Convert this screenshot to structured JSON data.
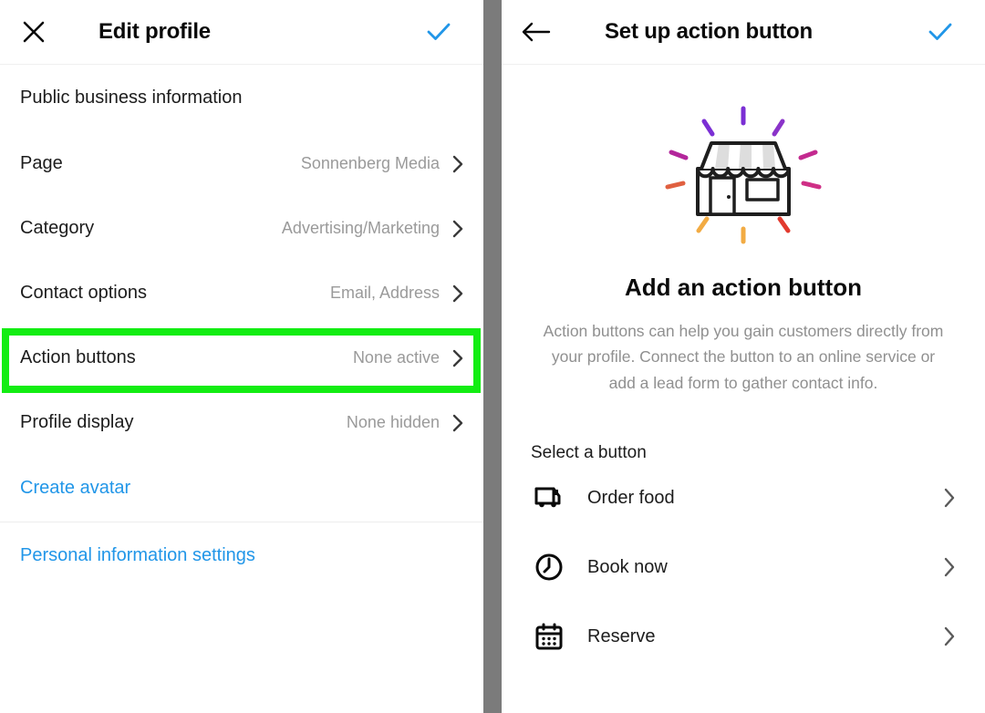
{
  "left_panel": {
    "header": {
      "close_icon": "close-icon",
      "title": "Edit profile",
      "confirm_icon": "check-icon"
    },
    "section_label": "Public business information",
    "rows": [
      {
        "label": "Page",
        "value": "Sonnenberg Media",
        "chevron": "chevron-right-icon"
      },
      {
        "label": "Category",
        "value": "Advertising/Marketing",
        "chevron": "chevron-right-icon"
      },
      {
        "label": "Contact options",
        "value": "Email, Address",
        "chevron": "chevron-right-icon"
      },
      {
        "label": "Action buttons",
        "value": "None active",
        "chevron": "chevron-right-icon"
      },
      {
        "label": "Profile display",
        "value": "None hidden",
        "chevron": "chevron-right-icon"
      }
    ],
    "links": [
      {
        "label": "Create avatar"
      },
      {
        "label": "Personal information settings"
      }
    ],
    "highlight_color": "#13ed13",
    "highlighted_row": "Action buttons"
  },
  "right_panel": {
    "header": {
      "back_icon": "arrow-left-icon",
      "title": "Set up action button",
      "confirm_icon": "check-icon"
    },
    "illustration": "storefront-icon",
    "hero_title": "Add an action button",
    "hero_body": "Action buttons can help you gain customers directly from your profile. Connect the button to an online service or add a lead form to gather contact info.",
    "select_label": "Select a button",
    "options": [
      {
        "label": "Order food",
        "icon": "delivery-truck-icon",
        "chevron": "chevron-right-icon"
      },
      {
        "label": "Book now",
        "icon": "clock-icon",
        "chevron": "chevron-right-icon"
      },
      {
        "label": "Reserve",
        "icon": "calendar-icon",
        "chevron": "chevron-right-icon"
      }
    ]
  },
  "colors": {
    "accent_blue": "#2196e8",
    "highlight_green": "#13ed13",
    "muted_text": "#9a9a9a",
    "divider_gray": "#7b7b7b"
  }
}
